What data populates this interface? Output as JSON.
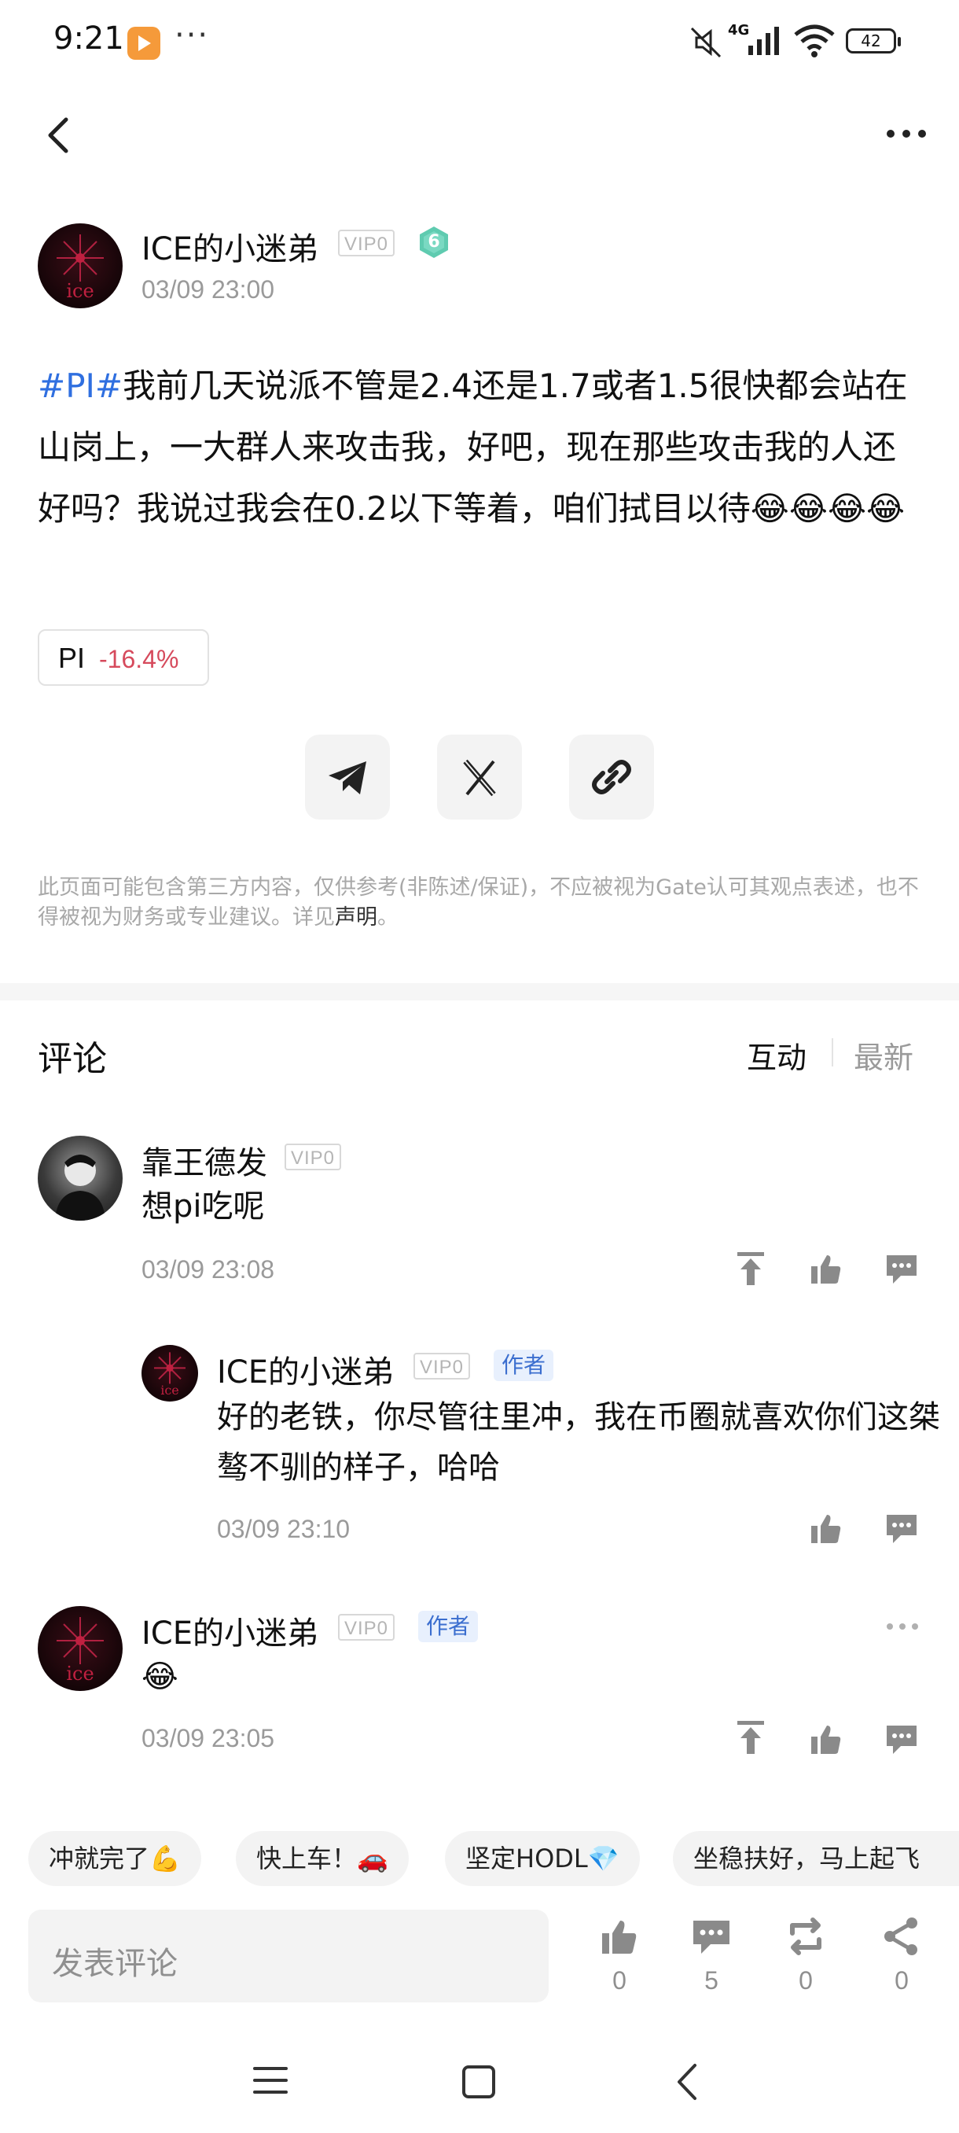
{
  "status_bar": {
    "time": "9:21",
    "battery": "42",
    "network": "4G"
  },
  "post": {
    "author": "ICE的小迷弟",
    "vip": "VIP0",
    "level": "6",
    "timestamp": "03/09 23:00",
    "tag": "#PI#",
    "body": "我前几天说派不管是2.4还是1.7或者1.5很快都会站在山岗上，一大群人来攻击我，好吧，现在那些攻击我的人还好吗？我说过我会在0.2以下等着，咱们拭目以待😂😂😂😂",
    "coin": {
      "symbol": "PI",
      "change": "-16.4%"
    },
    "disclaimer_text": "此页面可能包含第三方内容，仅供参考(非陈述/保证)，不应被视为Gate认可其观点表述，也不得被视为财务或专业建议。详见",
    "disclaimer_link": "声明",
    "disclaimer_end": "。"
  },
  "comments_section": {
    "title": "评论",
    "sort_options": [
      "互动",
      "最新"
    ],
    "comments": [
      {
        "user": "靠王德发",
        "vip": "VIP0",
        "text": "想pi吃呢",
        "time": "03/09 23:08"
      },
      {
        "user": "ICE的小迷弟",
        "vip": "VIP0",
        "badge": "作者",
        "text": "好的老铁，你尽管往里冲，我在币圈就喜欢你们这桀骜不驯的样子，哈哈",
        "time": "03/09 23:10"
      },
      {
        "user": "ICE的小迷弟",
        "vip": "VIP0",
        "badge": "作者",
        "text": "😂",
        "time": "03/09 23:05"
      }
    ]
  },
  "quick_replies": [
    "冲就完了💪",
    "快上车！🚗",
    "坚定HODL💎",
    "坐稳扶好，马上起飞"
  ],
  "bottom_bar": {
    "input_placeholder": "发表评论",
    "likes": "0",
    "comments": "5",
    "reposts": "0",
    "shares": "0"
  }
}
